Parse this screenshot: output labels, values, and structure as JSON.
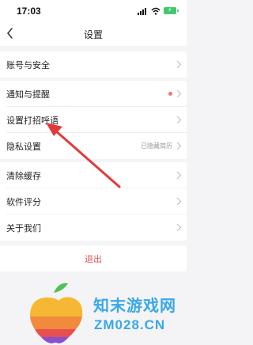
{
  "status_bar": {
    "time": "17:03"
  },
  "header": {
    "title": "设置"
  },
  "rows": [
    {
      "label": "账号与安全"
    },
    {
      "label": "通知与提醒"
    },
    {
      "label": "设置打招呼语"
    },
    {
      "label": "隐私设置",
      "value": "已隐藏简历"
    },
    {
      "label": "清除缓存"
    },
    {
      "label": "软件评分"
    },
    {
      "label": "关于我们"
    }
  ],
  "logout": {
    "label": "退出"
  },
  "watermark": {
    "title": "知末游戏网",
    "domain": "ZM028.CN"
  },
  "colors": {
    "accent_red": "#e25858",
    "notify_dot": "#f27474",
    "arrow": "#e23a3a",
    "watermark": "#3aa8e6"
  }
}
